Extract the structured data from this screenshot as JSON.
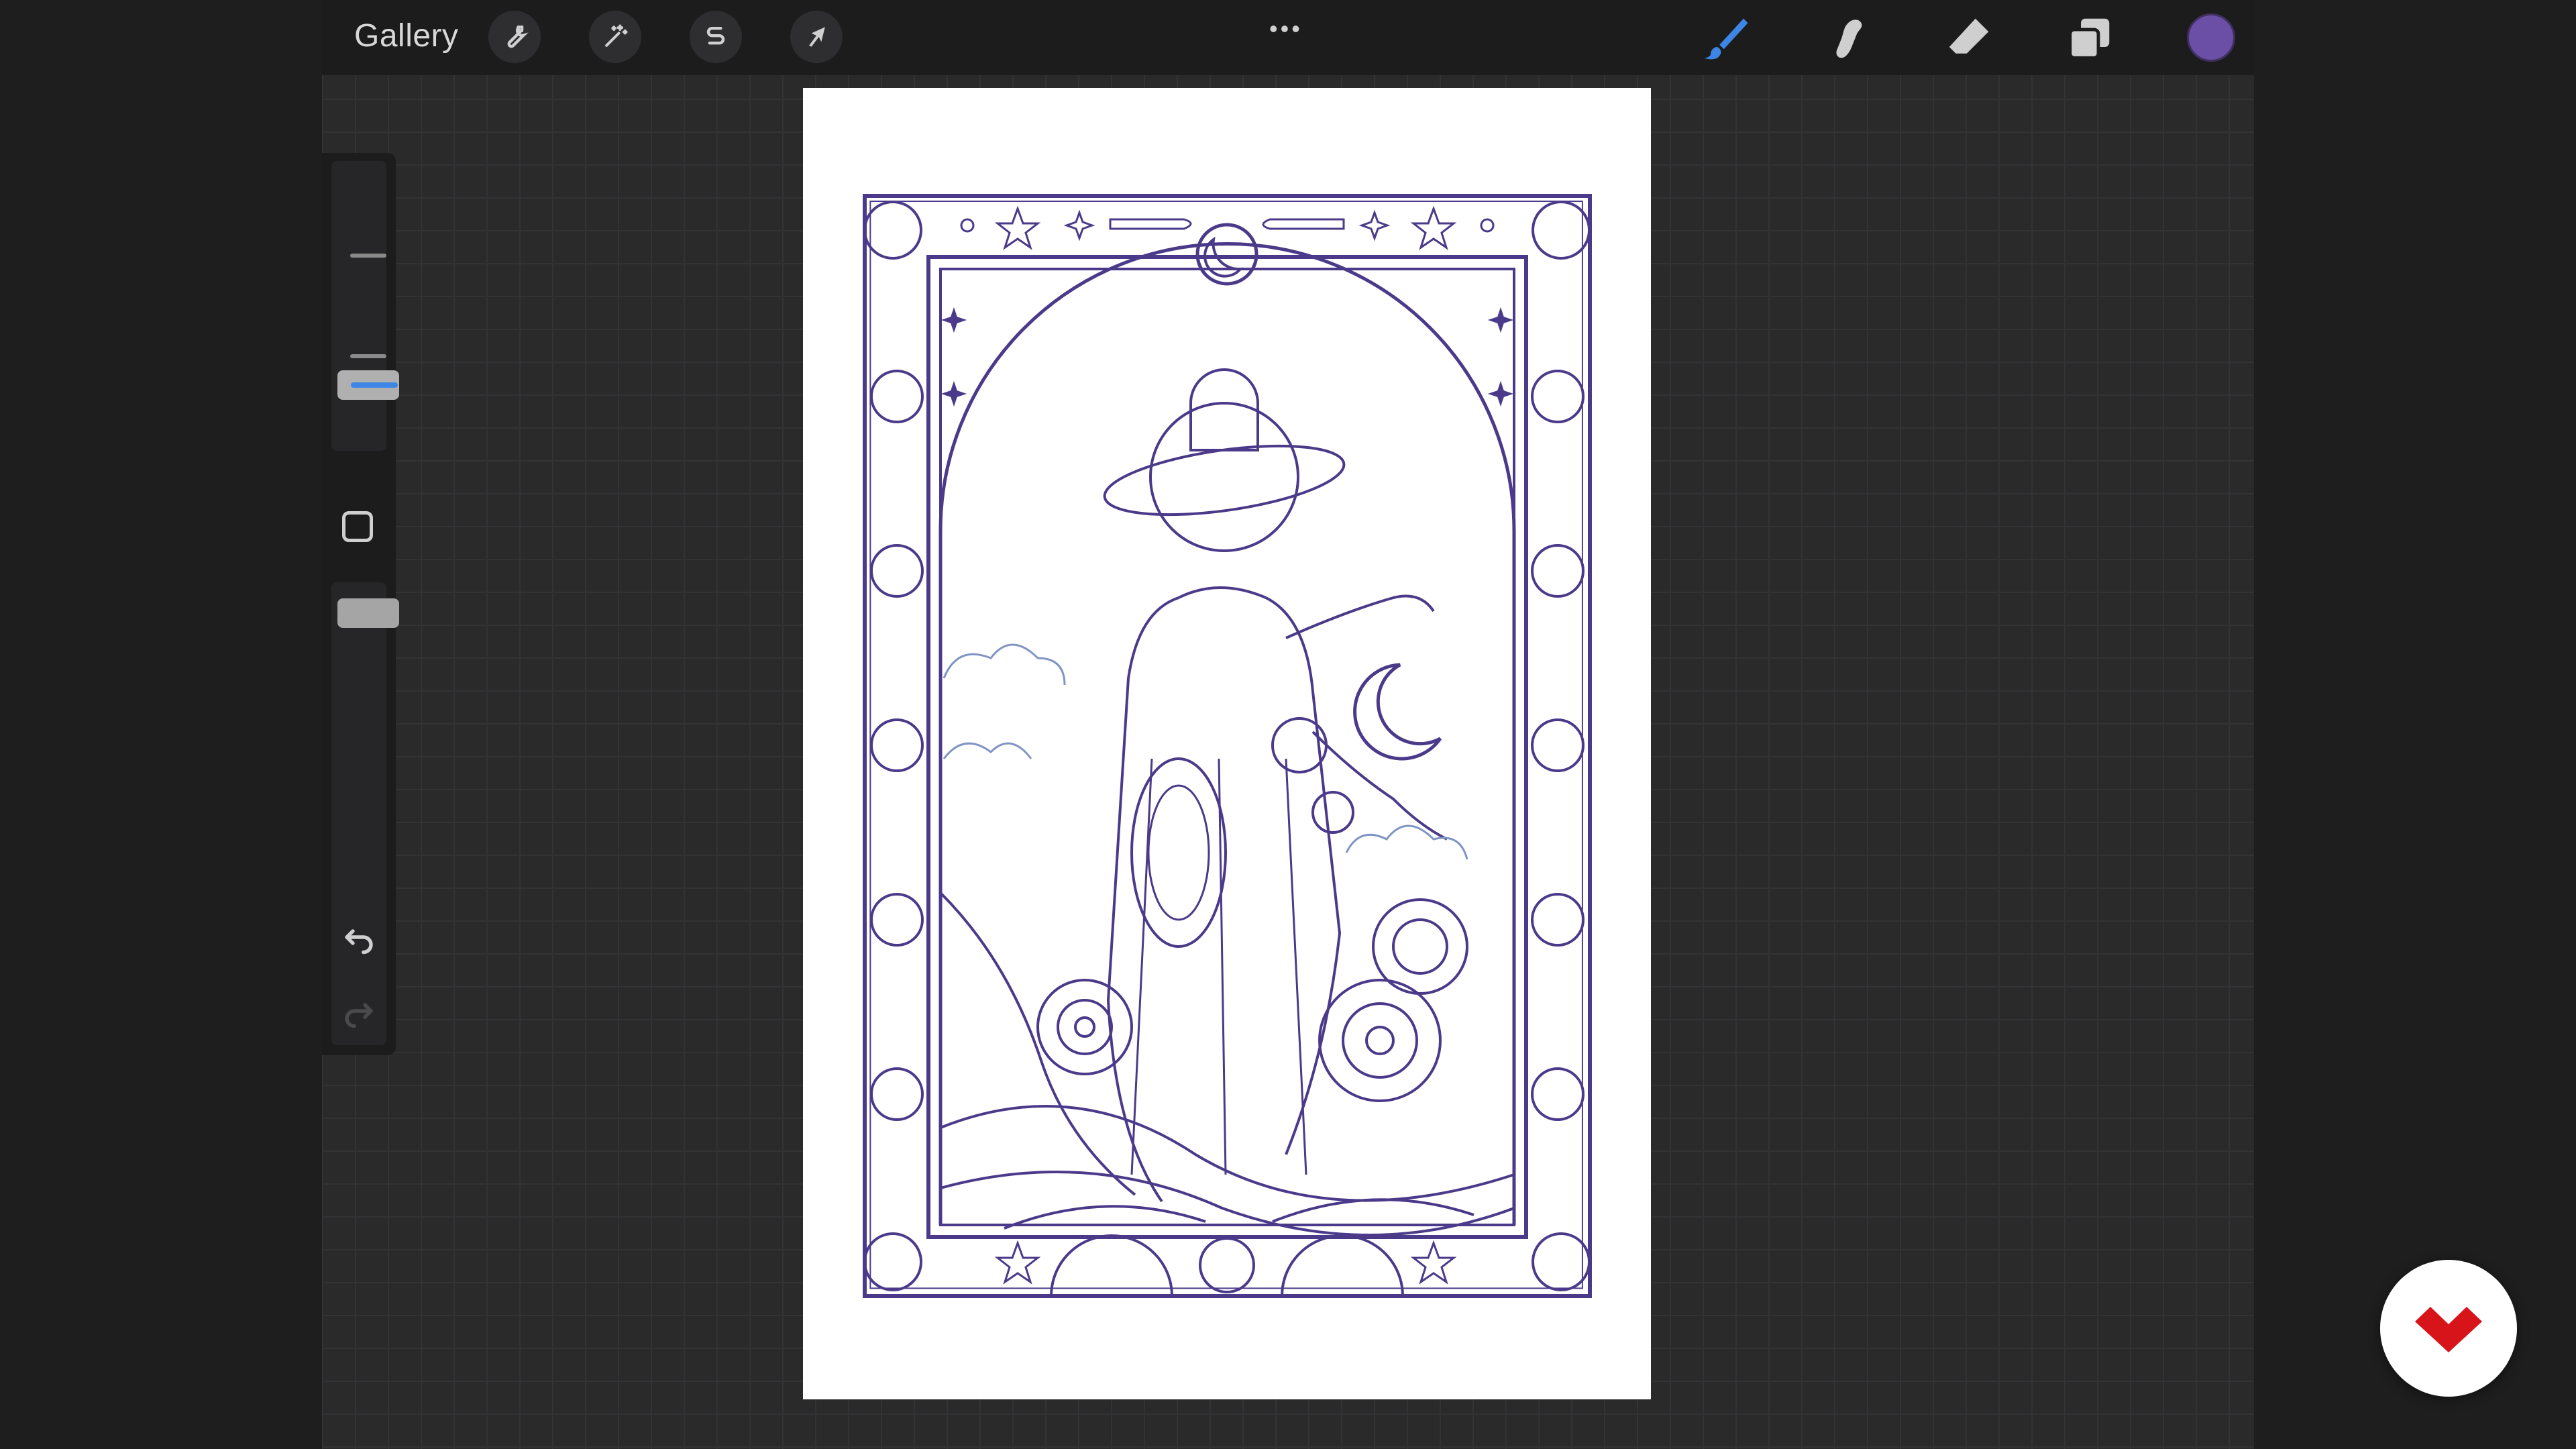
{
  "topbar": {
    "gallery_label": "Gallery",
    "left_tools": [
      "wrench-icon",
      "magic-wand-icon",
      "selection-icon",
      "transform-arrow-icon"
    ],
    "more_label": "•••",
    "right_tools": [
      "brush-icon",
      "smudge-icon",
      "eraser-icon",
      "layers-icon"
    ],
    "current_color": "#6b4fa6"
  },
  "sidebar": {
    "controls": [
      "brush-size-slider",
      "modify-square-button",
      "opacity-slider",
      "undo-button",
      "redo-button"
    ]
  },
  "canvas": {
    "line_color": "#4b3a8a",
    "sky_line_color": "#7f95c4"
  },
  "watermark": {
    "brand_color": "#d7141a"
  }
}
